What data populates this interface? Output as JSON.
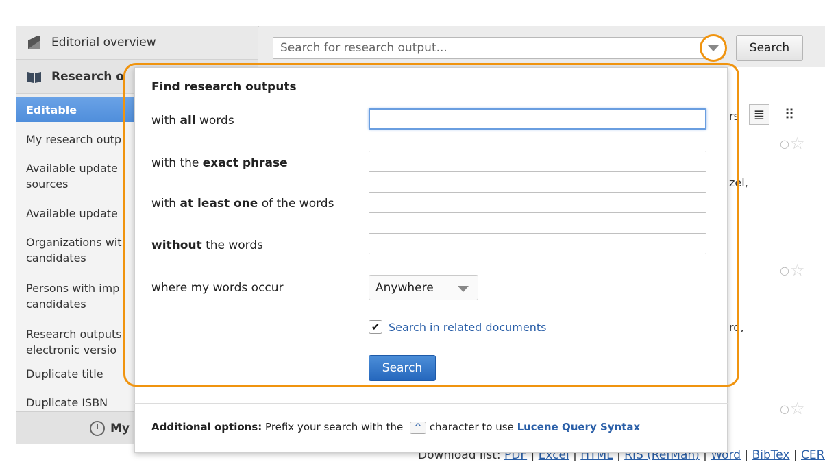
{
  "sidebar": {
    "editorial_overview": "Editorial overview",
    "research_header": "Research o",
    "items": [
      {
        "label": "Editable",
        "active": true
      },
      {
        "label": "My research outp"
      },
      {
        "label": "Available update",
        "label2": "sources"
      },
      {
        "label": "Available update"
      },
      {
        "label": "Organizations wit",
        "label2": "candidates"
      },
      {
        "label": "Persons with imp",
        "label2": "candidates"
      },
      {
        "label": "Research outputs",
        "label2": "electronic versio"
      },
      {
        "label": "Duplicate title"
      },
      {
        "label": "Duplicate ISBN"
      }
    ],
    "footer_label": "My"
  },
  "search": {
    "placeholder": "Search for research output...",
    "button_label": "Search"
  },
  "popup": {
    "title": "Find research outputs",
    "all_words": {
      "pre": "with ",
      "bold": "all",
      "post": " words"
    },
    "exact_phrase": {
      "pre": "with the ",
      "bold": "exact phrase",
      "post": ""
    },
    "at_least_one": {
      "pre": "with ",
      "bold": "at least one",
      "post": " of the words"
    },
    "without": {
      "pre": "",
      "bold": "without",
      "post": " the words"
    },
    "where_label": "where my words occur",
    "where_value": "Anywhere",
    "related_docs_label": "Search in related documents",
    "related_docs_checked": true,
    "search_button": "Search",
    "additional_label": "Additional options:",
    "additional_text": " Prefix your search with the",
    "caret_char": "^",
    "additional_text2": "character to use ",
    "lucene_link": "Lucene Query Syntax"
  },
  "results": {
    "frag_rs": "rs",
    "frag_zel": "zel,",
    "frag_rd": "rd,",
    "rating_symbol": "○",
    "star_symbol": "☆"
  },
  "download": {
    "label": "Download list: ",
    "links": [
      "PDF",
      "Excel",
      "HTML",
      "RIS (RefMan)",
      "Word",
      "BibTex",
      "CERIF XML"
    ]
  },
  "colors": {
    "highlight": "#f0940f",
    "active_blue": "#4f8edb",
    "link_blue": "#2a5fa8"
  }
}
